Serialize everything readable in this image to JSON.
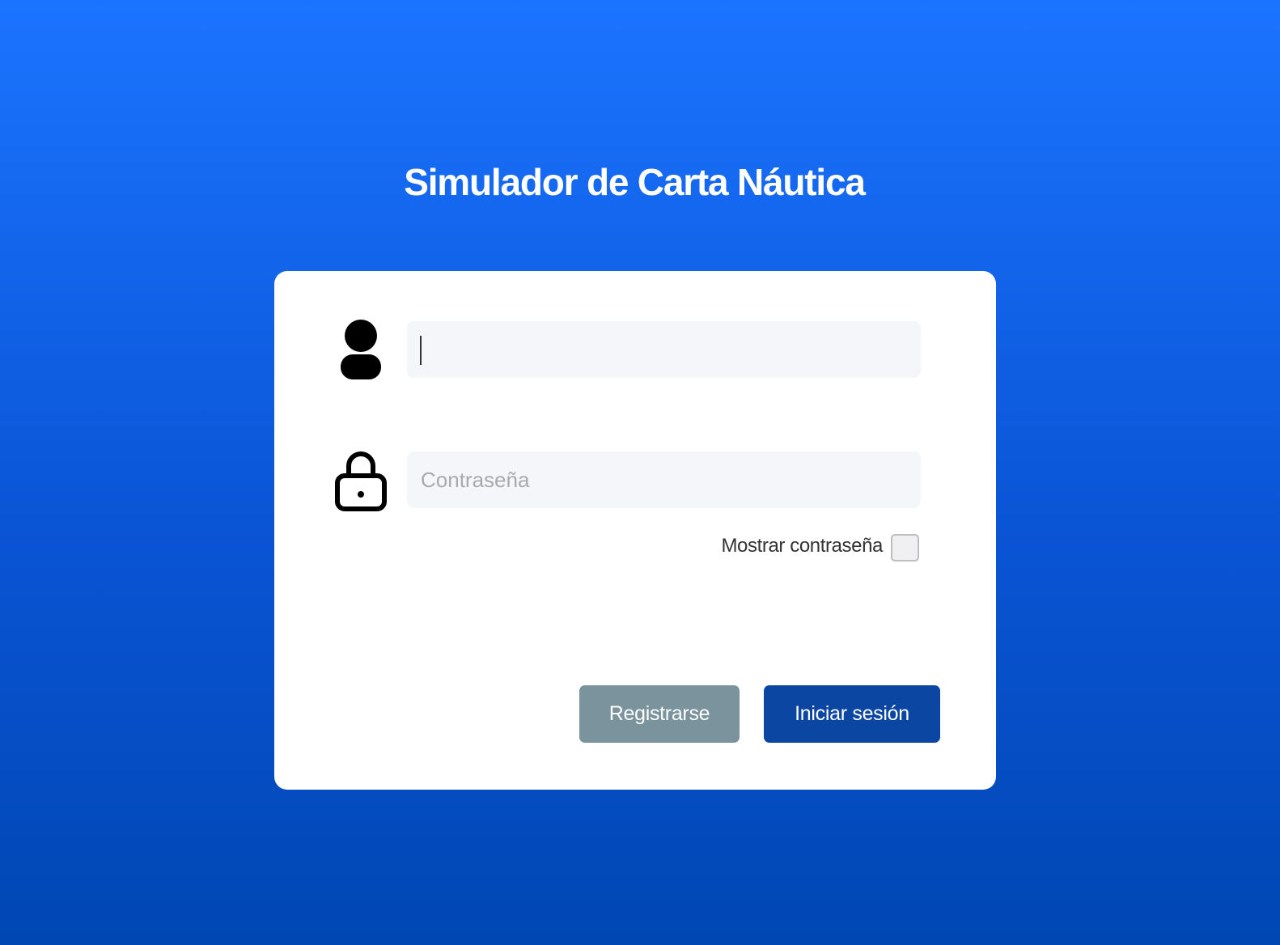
{
  "app": {
    "title": "Simulador de Carta Náutica"
  },
  "login_form": {
    "username": {
      "value": "",
      "placeholder": "",
      "icon": "user-icon"
    },
    "password": {
      "value": "",
      "placeholder": "Contraseña",
      "icon": "lock-icon"
    },
    "show_password": {
      "label": "Mostrar contraseña",
      "checked": false
    },
    "buttons": {
      "register_label": "Registrarse",
      "login_label": "Iniciar sesión"
    }
  },
  "colors": {
    "background_top": "#1b74ff",
    "background_bottom": "#0047b3",
    "register_button": "#7a939d",
    "login_button": "#0c46a3",
    "field_background": "#f5f6fa"
  }
}
